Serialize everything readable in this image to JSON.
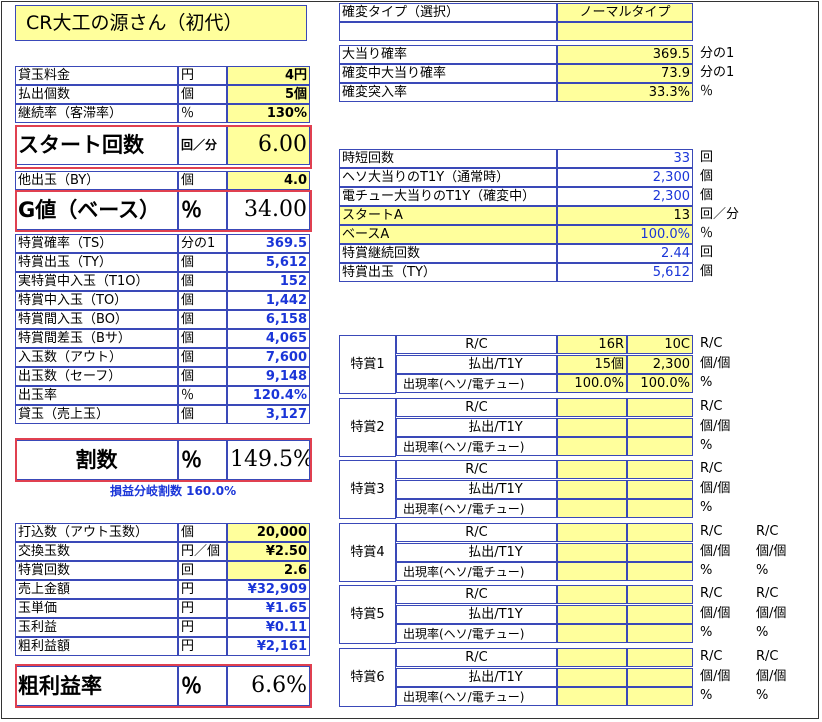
{
  "title": "CR大工の源さん（初代）",
  "left_top": [
    {
      "label": "貸玉料金",
      "unit": "円",
      "value": "4円"
    },
    {
      "label": "払出個数",
      "unit": "個",
      "value": "5個"
    },
    {
      "label": "継続率（客滞率）",
      "unit": "％",
      "value": "130%"
    }
  ],
  "start": {
    "label": "スタート回数",
    "unit": "回／分",
    "value": "6.00"
  },
  "by": {
    "label": "他出玉（BY）",
    "unit": "個",
    "value": "4.0"
  },
  "g": {
    "label": "G値（ベース）",
    "unit": "％",
    "value": "34.00"
  },
  "left_mid": [
    {
      "label": "特賞確率（TS）",
      "unit": "分の1",
      "value": "369.5"
    },
    {
      "label": "特賞出玉（TY）",
      "unit": "個",
      "value": "5,612"
    },
    {
      "label": "実特賞中入玉（T1O）",
      "unit": "個",
      "value": "152"
    },
    {
      "label": "特賞中入玉（TO）",
      "unit": "個",
      "value": "1,442"
    },
    {
      "label": "特賞間入玉（BO）",
      "unit": "個",
      "value": "6,158"
    },
    {
      "label": "特賞間差玉（Bサ）",
      "unit": "個",
      "value": "4,065"
    },
    {
      "label": "入玉数（アウト）",
      "unit": "個",
      "value": "7,600"
    },
    {
      "label": "出玉数（セーフ）",
      "unit": "個",
      "value": "9,148"
    },
    {
      "label": "出玉率",
      "unit": "％",
      "value": "120.4%"
    },
    {
      "label": "貸玉（売上玉）",
      "unit": "個",
      "value": "3,127"
    }
  ],
  "wari": {
    "label": "割数",
    "unit": "％",
    "value": "149.5%"
  },
  "breakeven": "損益分岐割数 160.0%",
  "left_bottom": [
    {
      "label": "打込数（アウト玉数）",
      "unit": "個",
      "value": "20,000"
    },
    {
      "label": "交換玉数",
      "unit": "円／個",
      "value": "¥2.50"
    },
    {
      "label": "特賞回数",
      "unit": "回",
      "value": "2.6"
    },
    {
      "label": "売上金額",
      "unit": "円",
      "value": "¥32,909"
    },
    {
      "label": "玉単価",
      "unit": "円",
      "value": "¥1.65"
    },
    {
      "label": "玉利益",
      "unit": "円",
      "value": "¥0.11"
    },
    {
      "label": "粗利益額",
      "unit": "円",
      "value": "¥2,161"
    }
  ],
  "arari": {
    "label": "粗利益率",
    "unit": "％",
    "value": "6.6%"
  },
  "kakuhen": {
    "label": "確変タイプ（選択）",
    "value": "ノーマルタイプ"
  },
  "right_a": [
    {
      "label": "大当り確率",
      "value": "369.5",
      "unit": "分の1"
    },
    {
      "label": "確変中大当り確率",
      "value": "73.9",
      "unit": "分の1"
    },
    {
      "label": "確変突入率",
      "value": "33.3%",
      "unit": "％"
    }
  ],
  "right_b": [
    {
      "label": "時短回数",
      "value": "33",
      "unit": "回"
    },
    {
      "label": "ヘソ大当りのT1Y（通常時）",
      "value": "2,300",
      "unit": "個"
    },
    {
      "label": "電チュー大当りのT1Y（確変中）",
      "value": "2,300",
      "unit": "個"
    },
    {
      "label": "スタートA",
      "value": "13",
      "unit": "回／分"
    },
    {
      "label": "ベースA",
      "value": "100.0%",
      "unit": "％"
    },
    {
      "label": "特賞継続回数",
      "value": "2.44",
      "unit": "回"
    },
    {
      "label": "特賞出玉（TY）",
      "value": "5,612",
      "unit": "個"
    }
  ],
  "tokusho_sub": [
    "R/C",
    "払出/T1Y",
    "出現率(ヘソ/電チュー)"
  ],
  "tokusho": [
    {
      "name": "特賞1",
      "v1": [
        "16R",
        "15個",
        "100.0%"
      ],
      "v2": [
        "10C",
        "2,300",
        "100.0%"
      ],
      "u1": [
        "R/C",
        "個/個",
        "%"
      ],
      "u2": [
        "",
        "",
        ""
      ]
    },
    {
      "name": "特賞2",
      "v1": [
        "",
        "",
        ""
      ],
      "v2": [
        "",
        "",
        ""
      ],
      "u1": [
        "R/C",
        "個/個",
        "%"
      ],
      "u2": [
        "",
        "",
        ""
      ]
    },
    {
      "name": "特賞3",
      "v1": [
        "",
        "",
        ""
      ],
      "v2": [
        "",
        "",
        ""
      ],
      "u1": [
        "R/C",
        "個/個",
        "%"
      ],
      "u2": [
        "",
        "",
        ""
      ]
    },
    {
      "name": "特賞4",
      "v1": [
        "",
        "",
        ""
      ],
      "v2": [
        "",
        "",
        ""
      ],
      "u1": [
        "R/C",
        "個/個",
        "%"
      ],
      "u2": [
        "R/C",
        "個/個",
        "%"
      ]
    },
    {
      "name": "特賞5",
      "v1": [
        "",
        "",
        ""
      ],
      "v2": [
        "",
        "",
        ""
      ],
      "u1": [
        "R/C",
        "個/個",
        "%"
      ],
      "u2": [
        "R/C",
        "個/個",
        "%"
      ]
    },
    {
      "name": "特賞6",
      "v1": [
        "",
        "",
        ""
      ],
      "v2": [
        "",
        "",
        ""
      ],
      "u1": [
        "R/C",
        "個/個",
        "%"
      ],
      "u2": [
        "R/C",
        "個/個",
        "%"
      ]
    }
  ]
}
